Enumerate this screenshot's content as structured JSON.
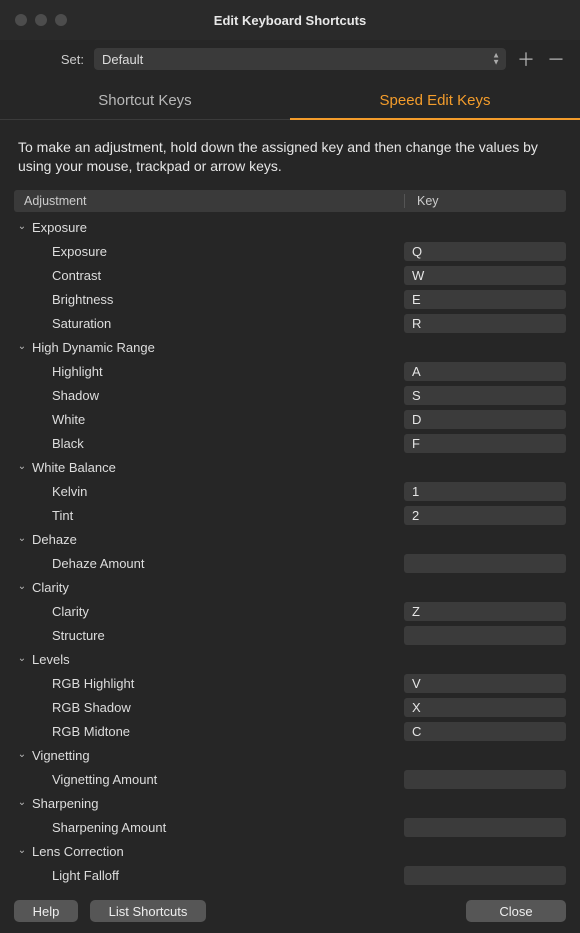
{
  "window": {
    "title": "Edit Keyboard Shortcuts"
  },
  "set": {
    "label": "Set:",
    "value": "Default"
  },
  "tabs": {
    "shortcutKeys": "Shortcut Keys",
    "speedEditKeys": "Speed Edit Keys"
  },
  "instructions": "To make an adjustment, hold down the assigned key and then change the values by using your mouse, trackpad or arrow keys.",
  "columns": {
    "adjustment": "Adjustment",
    "key": "Key"
  },
  "groups": [
    {
      "name": "Exposure",
      "items": [
        {
          "label": "Exposure",
          "key": "Q"
        },
        {
          "label": "Contrast",
          "key": "W"
        },
        {
          "label": "Brightness",
          "key": "E"
        },
        {
          "label": "Saturation",
          "key": "R"
        }
      ]
    },
    {
      "name": "High Dynamic Range",
      "items": [
        {
          "label": "Highlight",
          "key": "A"
        },
        {
          "label": "Shadow",
          "key": "S"
        },
        {
          "label": "White",
          "key": "D"
        },
        {
          "label": "Black",
          "key": "F"
        }
      ]
    },
    {
      "name": "White Balance",
      "items": [
        {
          "label": "Kelvin",
          "key": "1"
        },
        {
          "label": "Tint",
          "key": "2"
        }
      ]
    },
    {
      "name": "Dehaze",
      "items": [
        {
          "label": "Dehaze Amount",
          "key": ""
        }
      ]
    },
    {
      "name": "Clarity",
      "items": [
        {
          "label": "Clarity",
          "key": "Z"
        },
        {
          "label": "Structure",
          "key": ""
        }
      ]
    },
    {
      "name": "Levels",
      "items": [
        {
          "label": "RGB Highlight",
          "key": "V"
        },
        {
          "label": "RGB Shadow",
          "key": "X"
        },
        {
          "label": "RGB Midtone",
          "key": "C"
        }
      ]
    },
    {
      "name": "Vignetting",
      "items": [
        {
          "label": "Vignetting Amount",
          "key": ""
        }
      ]
    },
    {
      "name": "Sharpening",
      "items": [
        {
          "label": "Sharpening Amount",
          "key": ""
        }
      ]
    },
    {
      "name": "Lens Correction",
      "items": [
        {
          "label": "Light Falloff",
          "key": ""
        }
      ]
    }
  ],
  "footer": {
    "help": "Help",
    "list": "List Shortcuts",
    "close": "Close"
  }
}
